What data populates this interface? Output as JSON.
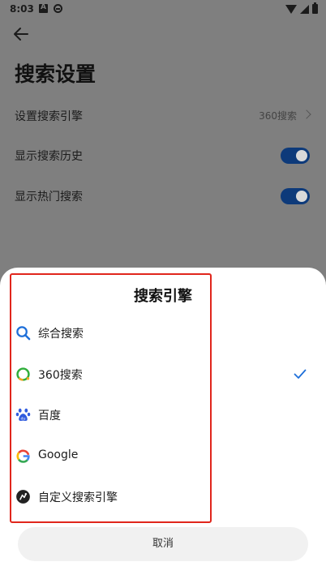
{
  "status_bar": {
    "time": "8:03"
  },
  "page": {
    "title": "搜索设置"
  },
  "settings": [
    {
      "label": "设置搜索引擎",
      "value": "360搜索"
    },
    {
      "label": "显示搜索历史",
      "toggle_on": true
    },
    {
      "label": "显示热门搜索",
      "toggle_on": true
    }
  ],
  "sheet": {
    "title": "搜索引擎",
    "options": [
      {
        "label": "综合搜索",
        "icon": "search-icon"
      },
      {
        "label": "360搜索",
        "icon": "360-logo-icon",
        "selected": true
      },
      {
        "label": "百度",
        "icon": "baidu-paw-icon"
      },
      {
        "label": "Google",
        "icon": "google-g-icon"
      },
      {
        "label": "自定义搜索引擎",
        "icon": "custom-engine-icon"
      }
    ],
    "cancel_label": "取消"
  },
  "colors": {
    "accent": "#1e6fd9",
    "scrim": "#7f7f7f",
    "highlight": "#e0261c",
    "toggle_on": "#0d3a7a"
  }
}
